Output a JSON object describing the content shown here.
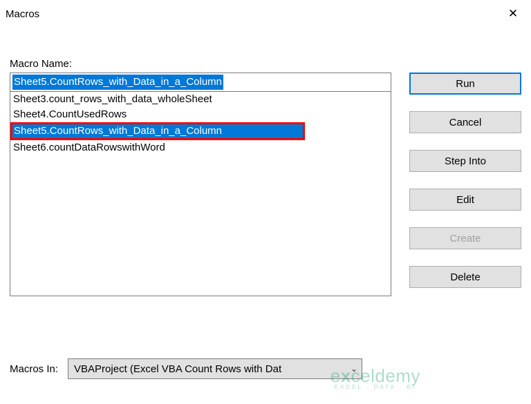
{
  "window": {
    "title": "Macros"
  },
  "labels": {
    "macro_name": "Macro Name:",
    "macros_in": "Macros In:"
  },
  "macro_name_value": "Sheet5.CountRows_with_Data_in_a_Column",
  "macro_list": [
    {
      "label": "Sheet3.count_rows_with_data_wholeSheet",
      "selected": false,
      "highlighted": false
    },
    {
      "label": "Sheet4.CountUsedRows",
      "selected": false,
      "highlighted": false
    },
    {
      "label": "Sheet5.CountRows_with_Data_in_a_Column",
      "selected": true,
      "highlighted": true
    },
    {
      "label": "Sheet6.countDataRowswithWord",
      "selected": false,
      "highlighted": false
    }
  ],
  "buttons": {
    "run": "Run",
    "cancel": "Cancel",
    "step_into": "Step Into",
    "edit": "Edit",
    "create": "Create",
    "delete": "Delete"
  },
  "macros_in_value": "VBAProject (Excel VBA Count Rows with Dat",
  "watermark": {
    "main_prefix": "e",
    "main_x": "x",
    "main_suffix": "celdemy",
    "sub": "EXCEL · DATA · BI"
  }
}
